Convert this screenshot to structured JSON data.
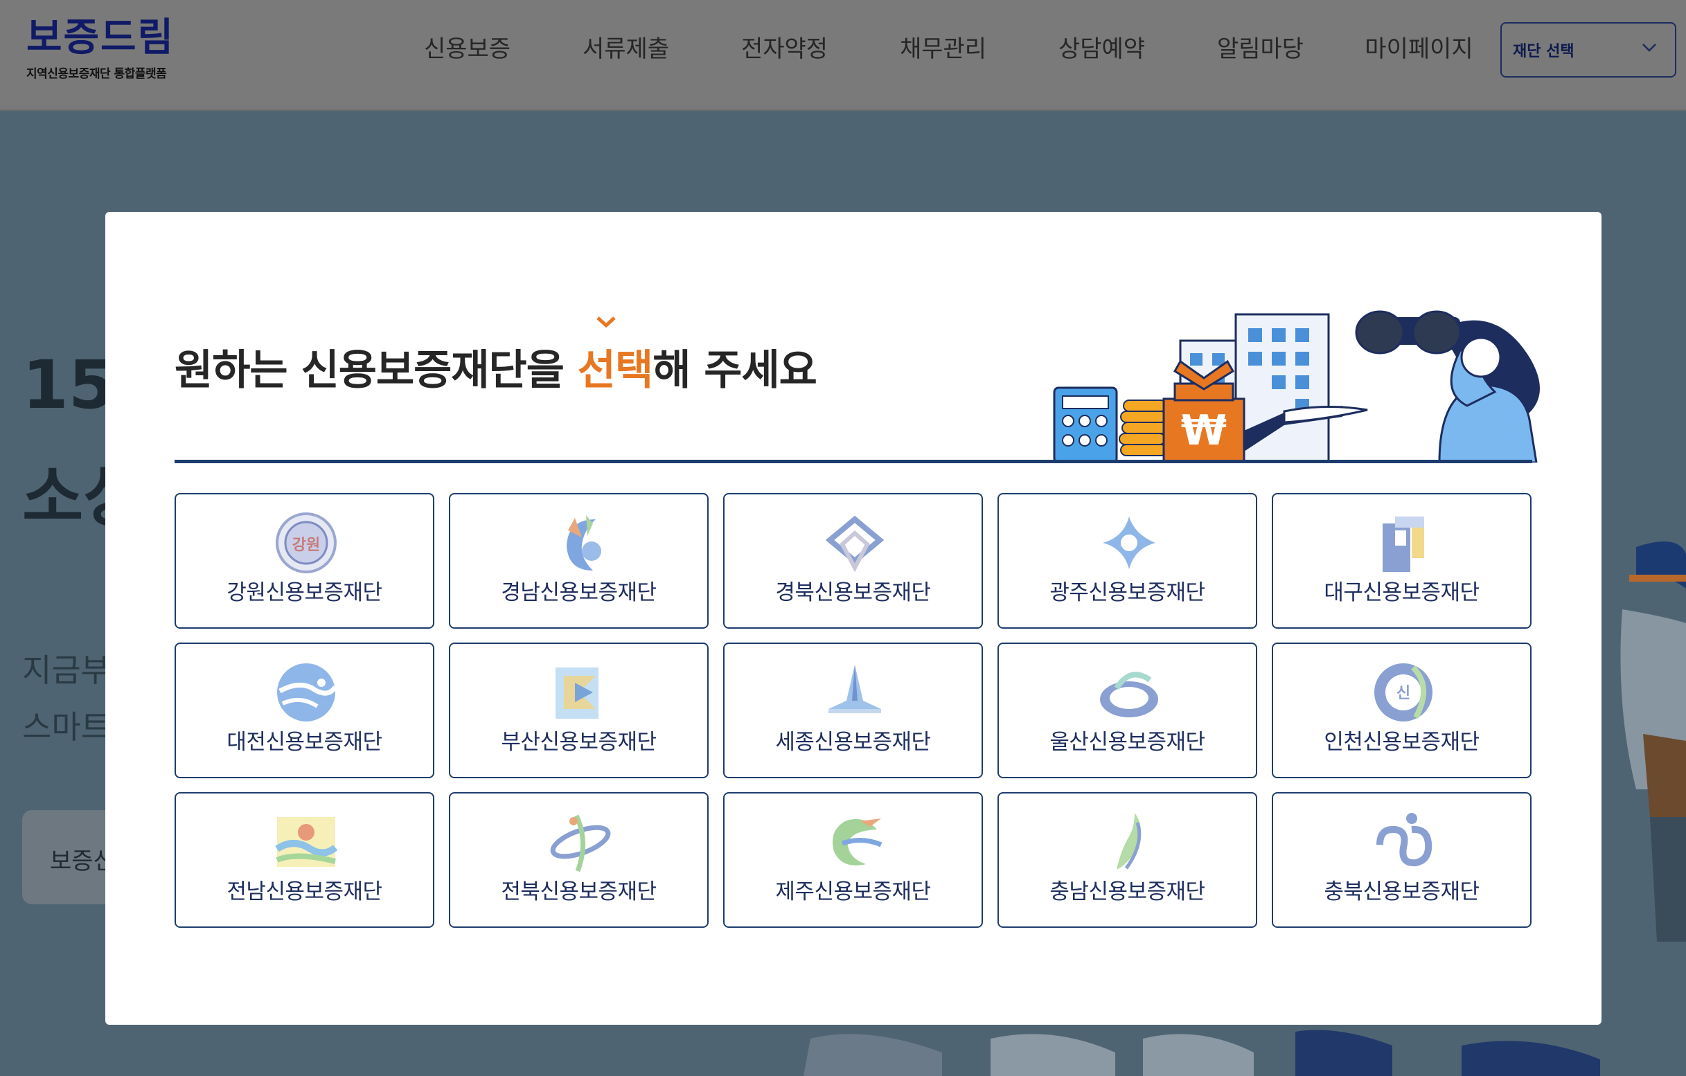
{
  "header": {
    "logo_title": "보증드림",
    "logo_subtitle": "지역신용보증재단 통합플랫폼",
    "nav": [
      {
        "label": "신용보증",
        "name": "nav-credit-guarantee"
      },
      {
        "label": "서류제출",
        "name": "nav-document-submission"
      },
      {
        "label": "전자약정",
        "name": "nav-e-agreement"
      },
      {
        "label": "채무관리",
        "name": "nav-debt-management"
      },
      {
        "label": "상담예약",
        "name": "nav-consultation"
      },
      {
        "label": "알림마당",
        "name": "nav-notice"
      },
      {
        "label": "마이페이지",
        "name": "nav-mypage"
      }
    ],
    "fund_select_label": "재단 선택",
    "fund_select_icon": "chevron-down-icon"
  },
  "hero": {
    "line1": "15",
    "line2": "소상",
    "line3": "지금부",
    "line4": "스마트",
    "button_label": "보증신"
  },
  "modal": {
    "title_before": "원하는 신용보증재단을 ",
    "title_accent": "선택",
    "title_after": "해 주세요",
    "accent_color": "#e87722",
    "foundations": [
      {
        "label": "강원신용보증재단",
        "emblem": "gangwon"
      },
      {
        "label": "경남신용보증재단",
        "emblem": "gyeongnam"
      },
      {
        "label": "경북신용보증재단",
        "emblem": "gyeongbuk"
      },
      {
        "label": "광주신용보증재단",
        "emblem": "gwangju"
      },
      {
        "label": "대구신용보증재단",
        "emblem": "daegu"
      },
      {
        "label": "대전신용보증재단",
        "emblem": "daejeon"
      },
      {
        "label": "부산신용보증재단",
        "emblem": "busan"
      },
      {
        "label": "세종신용보증재단",
        "emblem": "sejong"
      },
      {
        "label": "울산신용보증재단",
        "emblem": "ulsan"
      },
      {
        "label": "인천신용보증재단",
        "emblem": "incheon"
      },
      {
        "label": "전남신용보증재단",
        "emblem": "jeonnam"
      },
      {
        "label": "전북신용보증재단",
        "emblem": "jeonbuk"
      },
      {
        "label": "제주신용보증재단",
        "emblem": "jeju"
      },
      {
        "label": "충남신용보증재단",
        "emblem": "chungnam"
      },
      {
        "label": "충북신용보증재단",
        "emblem": "chungbuk"
      }
    ],
    "emblem_text": {
      "gangwon": "강원",
      "incheon": "신"
    }
  }
}
